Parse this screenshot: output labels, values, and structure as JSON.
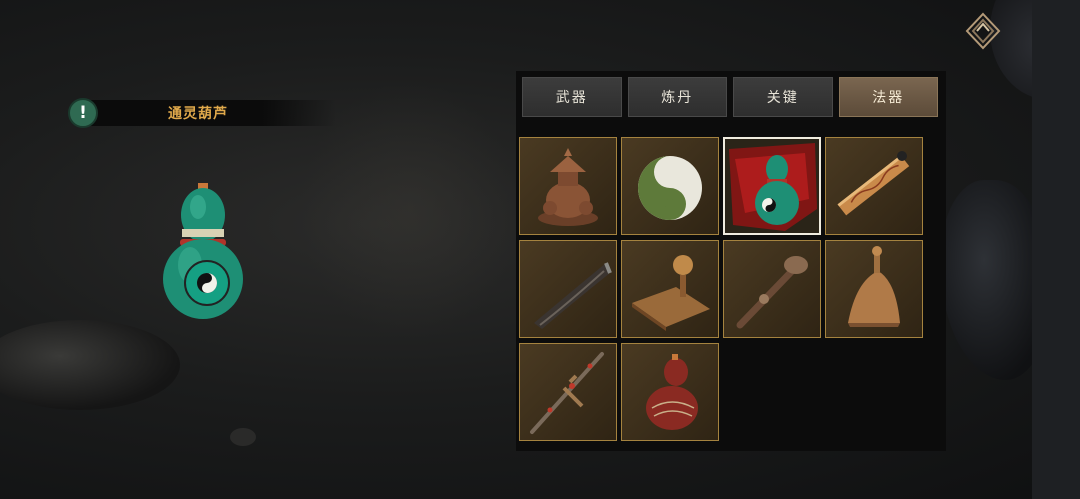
{
  "item_title": "通灵葫芦",
  "tabs": [
    {
      "label": "武器",
      "active": false
    },
    {
      "label": "炼丹",
      "active": false
    },
    {
      "label": "关键",
      "active": false
    },
    {
      "label": "法器",
      "active": true
    }
  ],
  "items": [
    {
      "icon": "pagoda-incense-burner-icon",
      "selected": false
    },
    {
      "icon": "yin-yang-jade-icon",
      "selected": false
    },
    {
      "icon": "spirit-gourd-icon",
      "selected": true
    },
    {
      "icon": "talisman-scroll-icon",
      "selected": false
    },
    {
      "icon": "horn-icon",
      "selected": false
    },
    {
      "icon": "seal-stamp-icon",
      "selected": false
    },
    {
      "icon": "ruyi-scepter-icon",
      "selected": false
    },
    {
      "icon": "bell-icon",
      "selected": false
    },
    {
      "icon": "jeweled-sword-icon",
      "selected": false
    },
    {
      "icon": "red-gourd-icon",
      "selected": false
    }
  ],
  "colors": {
    "title_gold": "#e0a94b",
    "slot_border": "#a5833f",
    "active_tab": "#6b5743",
    "alert_green": "#2f6a52"
  }
}
